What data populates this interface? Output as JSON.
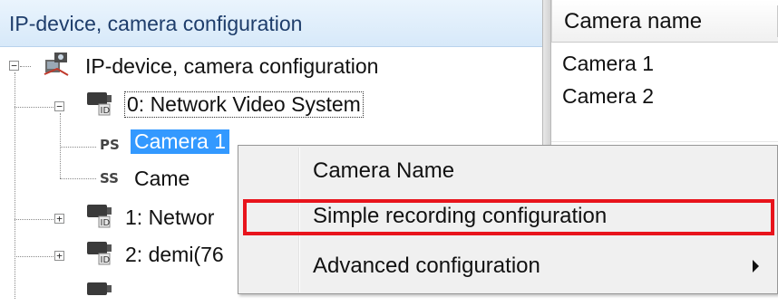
{
  "left_pane": {
    "header_title": "IP-device, camera configuration",
    "tree": {
      "root": {
        "label": "IP-device, camera configuration",
        "expander": "−"
      },
      "device0": {
        "label": "0: Network Video System",
        "expander": "−",
        "children": [
          {
            "badge": "PS",
            "label": "Camera 1"
          },
          {
            "badge": "SS",
            "label": "Came"
          }
        ]
      },
      "device1": {
        "label": "1: Networ",
        "expander": "+"
      },
      "device2": {
        "label": "2: demi(76",
        "expander": "+"
      }
    }
  },
  "right_pane": {
    "column_header": "Camera name",
    "rows": [
      "Camera 1",
      "Camera 2"
    ]
  },
  "context_menu": {
    "items": [
      {
        "label": "Camera Name"
      },
      {
        "label": "Simple recording configuration",
        "highlighted": true
      },
      {
        "label": "Advanced configuration",
        "has_submenu": true
      }
    ]
  },
  "colors": {
    "selection": "#3399ff",
    "highlight_box": "#e8141c",
    "header_text": "#1e3d6b"
  },
  "icons": {
    "root": "network-devices-icon",
    "device": "camera-device-icon",
    "submenu": "submenu-arrow-icon"
  }
}
